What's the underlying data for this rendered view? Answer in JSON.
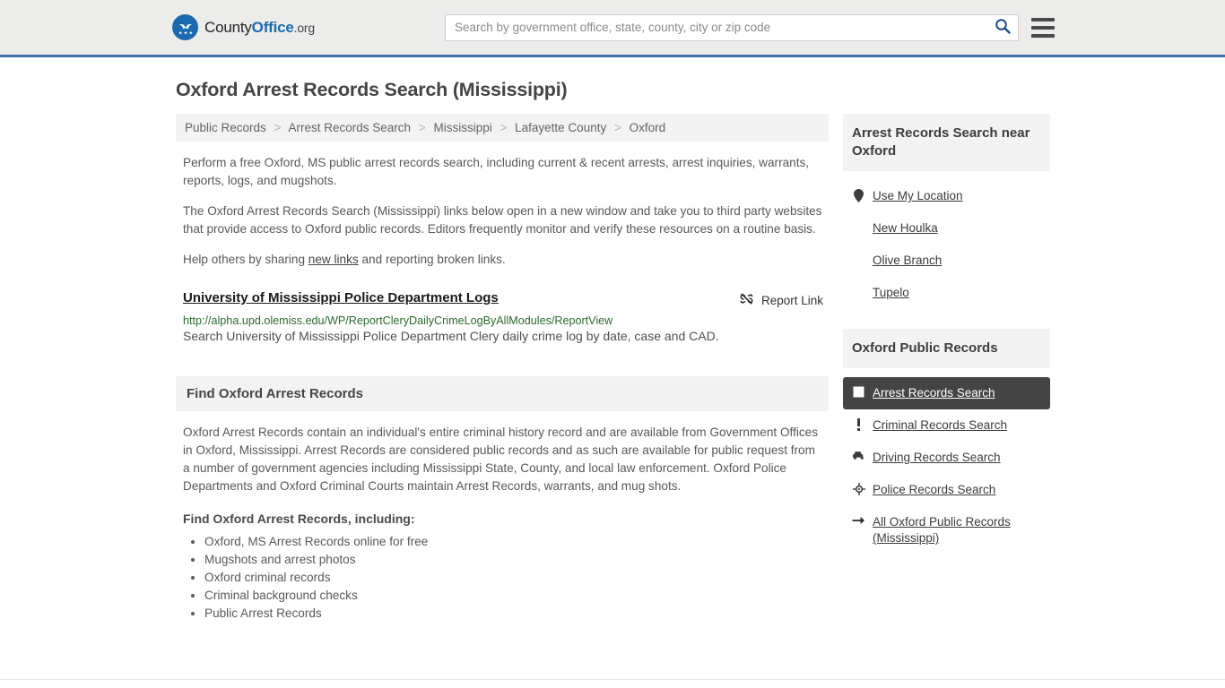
{
  "header": {
    "brand": {
      "part1": "County",
      "part2": "Office",
      "part3": ".org",
      "icon": "eagle-seal-icon"
    },
    "search": {
      "value": "",
      "placeholder": "Search by government office, state, county, city or zip code",
      "icon": "search-icon"
    },
    "menu_icon": "hamburger-menu-icon",
    "accent_color": "#3a72a8",
    "background_color": "#ececeb"
  },
  "page": {
    "title": "Oxford Arrest Records Search (Mississippi)"
  },
  "breadcrumb": {
    "separator": ">",
    "items": [
      {
        "label": "Public Records"
      },
      {
        "label": "Arrest Records Search"
      },
      {
        "label": "Mississippi"
      },
      {
        "label": "Lafayette County"
      },
      {
        "label": "Oxford"
      }
    ]
  },
  "intro": {
    "paragraph1": "Perform a free Oxford, MS public arrest records search, including current & recent arrests, arrest inquiries, warrants, reports, logs, and mugshots.",
    "paragraph2": "The Oxford Arrest Records Search (Mississippi) links below open in a new window and take you to third party websites that provide access to Oxford public records. Editors frequently monitor and verify these resources on a routine basis.",
    "paragraph3_prefix": "Help others by sharing ",
    "paragraph3_link": "new links",
    "paragraph3_suffix": " and reporting broken links."
  },
  "result": {
    "title": "University of Mississippi Police Department Logs",
    "url": "http://alpha.upd.olemiss.edu/WP/ReportCleryDailyCrimeLogByAllModules/ReportView",
    "description": "Search University of Mississippi Police Department Clery daily crime log by date, case and CAD.",
    "report_label": "Report Link",
    "report_icon": "broken-link-icon",
    "url_color": "#2b6b2b"
  },
  "find_section": {
    "heading": "Find Oxford Arrest Records",
    "body": "Oxford Arrest Records contain an individual's entire criminal history record and are available from Government Offices in Oxford, Mississippi. Arrest Records are considered public records and as such are available for public request from a number of government agencies including Mississippi State, County, and local law enforcement. Oxford Police Departments and Oxford Criminal Courts maintain Arrest Records, warrants, and mug shots.",
    "sub_heading": "Find Oxford Arrest Records, including:",
    "bullets": [
      "Oxford, MS Arrest Records online for free",
      "Mugshots and arrest photos",
      "Oxford criminal records",
      "Criminal background checks",
      "Public Arrest Records"
    ]
  },
  "sidebar": {
    "near_block": {
      "heading": "Arrest Records Search near Oxford",
      "items": [
        {
          "label": "Use My Location",
          "icon": "map-pin-icon"
        },
        {
          "label": "New Houlka",
          "icon": ""
        },
        {
          "label": "Olive Branch",
          "icon": ""
        },
        {
          "label": "Tupelo",
          "icon": ""
        }
      ]
    },
    "records_block": {
      "heading": "Oxford Public Records",
      "items": [
        {
          "label": "Arrest Records Search",
          "icon": "handcuffs-icon",
          "active": true
        },
        {
          "label": "Criminal Records Search",
          "icon": "exclamation-icon",
          "active": false
        },
        {
          "label": "Driving Records Search",
          "icon": "car-icon",
          "active": false
        },
        {
          "label": "Police Records Search",
          "icon": "police-badge-icon",
          "active": false
        },
        {
          "label": "All Oxford Public Records (Mississippi)",
          "icon": "arrow-right-icon",
          "active": false
        }
      ],
      "active_background": "#444444"
    }
  }
}
